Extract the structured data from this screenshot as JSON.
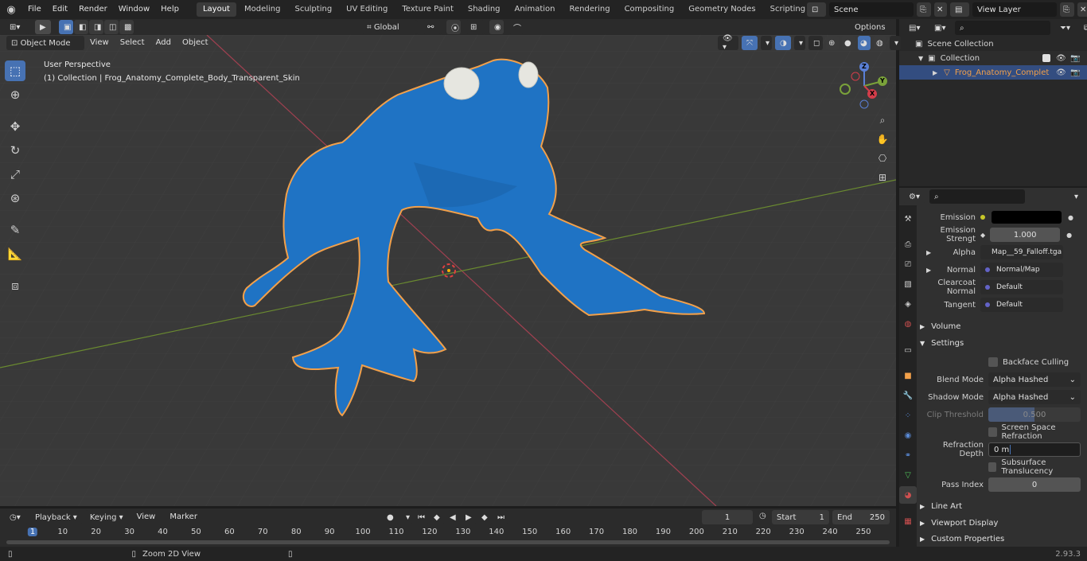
{
  "topbar": {
    "menus": [
      "File",
      "Edit",
      "Render",
      "Window",
      "Help"
    ],
    "workspaces": [
      "Layout",
      "Modeling",
      "Sculpting",
      "UV Editing",
      "Texture Paint",
      "Shading",
      "Animation",
      "Rendering",
      "Compositing",
      "Geometry Nodes",
      "Scripting"
    ],
    "active_workspace": "Layout",
    "scene": "Scene",
    "view_layer": "View Layer"
  },
  "viewport_header": {
    "mode": "Object Mode",
    "menus": [
      "View",
      "Select",
      "Add",
      "Object"
    ],
    "transform": "Global",
    "options": "Options"
  },
  "viewport": {
    "perspective": "User Perspective",
    "collection_info": "(1) Collection | Frog_Anatomy_Complete_Body_Transparent_Skin",
    "gizmo_axes": [
      "Z",
      "Y",
      "X"
    ],
    "accent_color": "#4772b3",
    "object_color": "#1f73c4",
    "outline_color": "#f2a04a"
  },
  "outliner": {
    "scene_collection": "Scene Collection",
    "collection": "Collection",
    "object": "Frog_Anatomy_Complet"
  },
  "properties": {
    "emission": {
      "label": "Emission"
    },
    "emission_strength": {
      "label": "Emission Strengt",
      "value": "1.000"
    },
    "alpha": {
      "label": "Alpha",
      "value": "Map__59_Falloff.tga"
    },
    "normal": {
      "label": "Normal",
      "value": "Normal/Map"
    },
    "clearcoat_normal": {
      "label": "Clearcoat Normal",
      "value": "Default"
    },
    "tangent": {
      "label": "Tangent",
      "value": "Default"
    },
    "volume": "Volume",
    "settings": "Settings",
    "backface_culling": "Backface Culling",
    "blend_mode": {
      "label": "Blend Mode",
      "value": "Alpha Hashed"
    },
    "shadow_mode": {
      "label": "Shadow Mode",
      "value": "Alpha Hashed"
    },
    "clip_threshold": {
      "label": "Clip Threshold",
      "value": "0.500",
      "fraction": 0.5
    },
    "screen_space_refraction": "Screen Space Refraction",
    "refraction_depth": {
      "label": "Refraction Depth",
      "value": "0 m"
    },
    "subsurface_translucency": "Subsurface Translucency",
    "pass_index": {
      "label": "Pass Index",
      "value": "0"
    },
    "line_art": "Line Art",
    "viewport_display": "Viewport Display",
    "custom_properties": "Custom Properties"
  },
  "timeline": {
    "menus": [
      "Playback",
      "Keying",
      "View",
      "Marker"
    ],
    "current_frame": "1",
    "start_label": "Start",
    "start": "1",
    "end_label": "End",
    "end": "250",
    "ticks": [
      "1",
      "10",
      "20",
      "30",
      "40",
      "50",
      "60",
      "70",
      "80",
      "90",
      "100",
      "110",
      "120",
      "130",
      "140",
      "150",
      "160",
      "170",
      "180",
      "190",
      "200",
      "210",
      "220",
      "230",
      "240",
      "250"
    ]
  },
  "statusbar": {
    "hint": "Zoom 2D View",
    "version": "2.93.3"
  }
}
